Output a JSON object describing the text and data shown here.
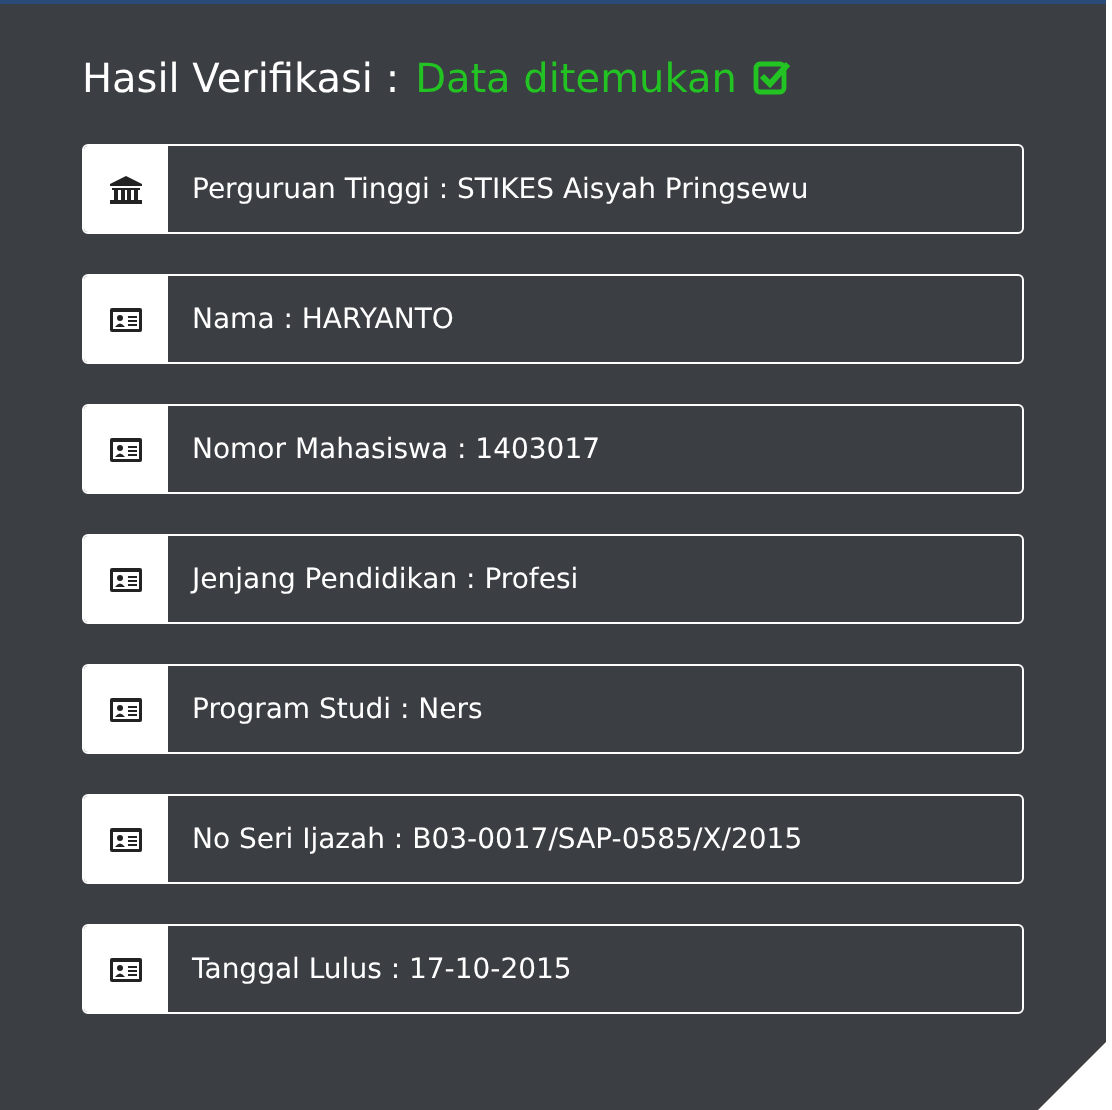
{
  "heading": {
    "label": "Hasil Verifikasi :",
    "status": "Data ditemukan",
    "found": true
  },
  "fields": [
    {
      "kind": "institution",
      "text": "Perguruan Tinggi : STIKES Aisyah Pringsewu"
    },
    {
      "kind": "id",
      "text": "Nama : HARYANTO"
    },
    {
      "kind": "id",
      "text": "Nomor Mahasiswa : 1403017"
    },
    {
      "kind": "id",
      "text": "Jenjang Pendidikan : Profesi"
    },
    {
      "kind": "id",
      "text": "Program Studi : Ners"
    },
    {
      "kind": "id",
      "text": "No Seri Ijazah : B03-0017/SAP-0585/X/2015"
    },
    {
      "kind": "id",
      "text": "Tanggal Lulus : 17-10-2015"
    }
  ]
}
